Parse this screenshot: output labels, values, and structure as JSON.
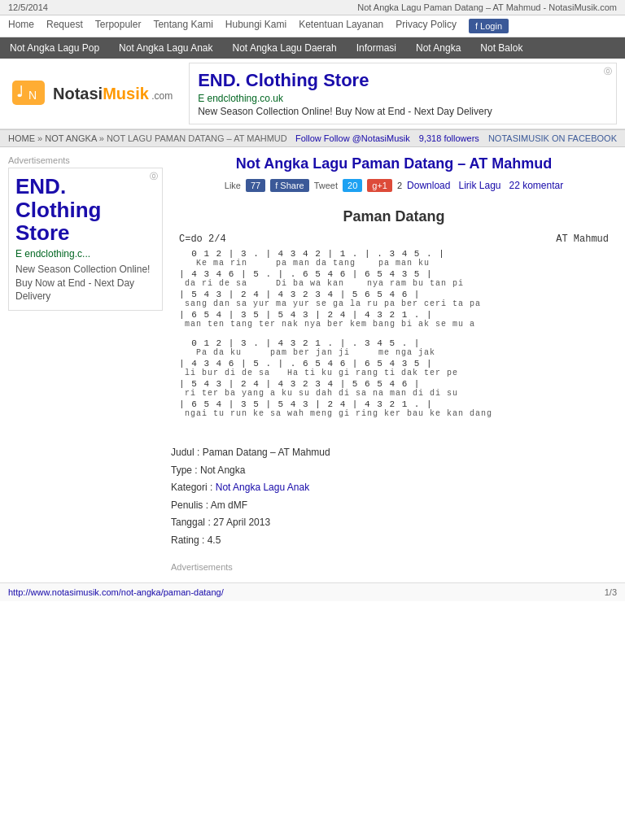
{
  "browser": {
    "date": "12/5/2014",
    "page_title": "Not Angka Lagu Paman Datang – AT Mahmud - NotasiMusik.com",
    "url": "http://www.notasimusik.com/not-angka/paman-datang/"
  },
  "nav": {
    "home": "Home",
    "request": "Request",
    "terpopuler": "Terpopuler",
    "tentang": "Tentang Kami",
    "hubungi": "Hubungi Kami",
    "ketentuan": "Ketentuan Layanan",
    "privacy": "Privacy Policy",
    "login": "f  Login"
  },
  "cat_nav": {
    "items": [
      "Not Angka Lagu Pop",
      "Not Angka Lagu Anak",
      "Not Angka Lagu Daerah",
      "Informasi",
      "Not Angka",
      "Not Balok"
    ]
  },
  "logo": {
    "site_name": "NotasiMusik",
    "dot_com": ".com"
  },
  "ad_banner": {
    "title": "END. Clothing Store",
    "domain": "E  endclothing.co.uk",
    "description": "New Season Collection Online! Buy Now at End - Next Day Delivery",
    "small": "⓪"
  },
  "breadcrumb": {
    "home": "HOME",
    "not_angka": "NOT ANGKA",
    "current": "NOT LAGU PAMAN DATANG – AT MAHMUD"
  },
  "follow": {
    "text": "Follow @NotasiMusik",
    "followers": "9,318 followers",
    "facebook": "NOTASIMUSIK ON FACEBOOK"
  },
  "sidebar_ads_label": "Advertisements",
  "sidebar_ad": {
    "title": "END. Clothing Store",
    "domain": "E  endclothing.c...",
    "description": "New Season Collection Online! Buy Now at End - Next Day Delivery"
  },
  "article": {
    "title": "Not Angka Lagu Paman Datang – AT Mahmud",
    "social": {
      "like_label": "Like",
      "like_count": "77",
      "share_label": "f Share",
      "tweet_label": "Tweet",
      "tweet_count": "20",
      "gplus_label": "g+1",
      "gplus_count": "2"
    },
    "actions": {
      "download": "Download",
      "lirik": "Lirik Lagu",
      "komentar": "22 komentar"
    },
    "sheet": {
      "song_title": "Paman Datang",
      "key": "C=do  2/4",
      "composer": "AT Mahmud",
      "lines": [
        {
          "notes": "  0  1  2 |  3  .  | 4  3  4  2 |  1  .  | .  3  4  5  .  |",
          "lyrics": "   Ke  ma  rin      pa  man  da  tang      pa  man  ku"
        },
        {
          "notes": "| 4  3  4  6 |  5  .  | .  6  5  4  6 |  6  5  4  3  5 |",
          "lyrics": " da  ri  de  sa      Di  ba  wa  kan      nya  ram bu  tan  pi"
        },
        {
          "notes": "| 5  4  3  |  2  4  | 4  3  2  3  4 |  5  6  5  4  6 |",
          "lyrics": " sang  dan  sa  yur  ma  yur  se  ga  la  ru  pa  ber  ceri  ta  pa"
        },
        {
          "notes": "| 6  5  4  |  3  5  | 5  4  3  |  2  4  |  4  3  2  1  .  |",
          "lyrics": " man  ten tang  ter  nak  nya  ber  kem  bang  bi  ak  se  mu  a"
        },
        {
          "notes": "  0  1  2  |  3  .  | 4  3  2  1  .  | .  3  4  5  .  |",
          "lyrics": "   Pa  da  ku      pam  ber jan  ji      me  nga  jak"
        },
        {
          "notes": "| 4  3  4  6 |  5  .  | .  6  5  4  6 |  6  5  4  3  5 |",
          "lyrics": " li  bur  di  de  sa      Ha  ti  ku  gi  rang  ti  dak  ter  pe"
        },
        {
          "notes": "| 5  4  3  |  2  4  | 4  3  2  3  4 |  5  6  5  4  6 |",
          "lyrics": " ri  ter  ba  yang  a  ku  su  dah  di  sa  na  man  di  di  su"
        },
        {
          "notes": "| 6  5  4  |  3  5  | 5  4  3  |  2  4  |  4  3  2  1  .  |",
          "lyrics": " ngai  tu  run  ke  sa  wah  meng  gi  ring  ker  bau  ke  kan  dang"
        }
      ]
    },
    "info": {
      "judul_label": "Judul",
      "judul_value": ": Paman Datang – AT Mahmud",
      "type_label": "Type",
      "type_value": ": Not Angka",
      "kategori_label": "Kategori",
      "kategori_value": "Not Angka Lagu Anak",
      "penulis_label": "Penulis",
      "penulis_value": ": Am dMF",
      "tanggal_label": "Tanggal",
      "tanggal_value": ": 27 April 2013",
      "rating_label": "Rating",
      "rating_value": ": 4.5"
    }
  },
  "footer": {
    "url": "http://www.notasimusik.com/not-angka/paman-datang/",
    "page": "1/3"
  }
}
